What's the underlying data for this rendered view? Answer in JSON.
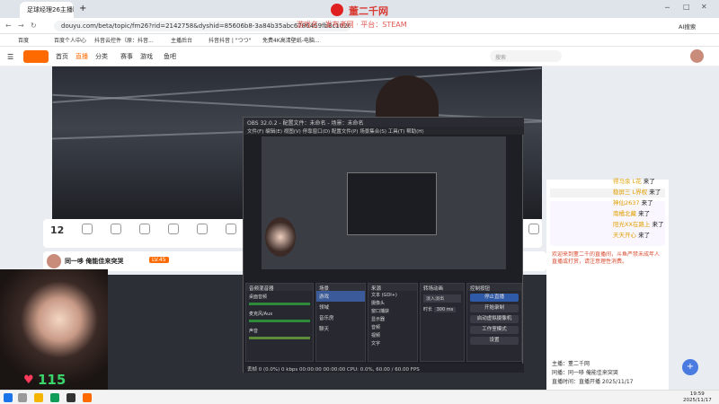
{
  "browser": {
    "tab_title": "足球经理26主播职",
    "url": "douyu.com/beta/topic/fm26?rid=2142758&dyshid=85606b8-3a84b35abc6786469fb8c10200011701",
    "ai_label": "AI搜索",
    "bookmarks": [
      "百度",
      "百度个人中心",
      "抖音云控件（原：抖音...",
      "抖音云控件",
      "主播后台",
      "抖音抖音 | \"つつ\"",
      "免费4K高清壁纸-电脑..."
    ]
  },
  "overlay": {
    "logo_text": "董二千网",
    "subtitle": "游戏名 · 发布者网 · 平台：STEAM"
  },
  "site": {
    "nav": [
      "首页",
      "直播",
      "分类",
      "赛事",
      "游戏",
      "鱼吧"
    ],
    "search_placeholder": "搜索"
  },
  "toolbar": {
    "count": "12",
    "items": [
      "",
      "",
      "",
      "",
      "",
      "",
      "",
      "",
      "",
      "",
      "",
      "",
      ""
    ]
  },
  "stream": {
    "streamer_name": "同一哆 俺能佳来突哭",
    "level": "LV.45"
  },
  "chat_float": [
    {
      "name": "得马余 L花",
      "action": "来了"
    },
    {
      "name": "稳屏三 L界权",
      "action": "来了"
    },
    {
      "name": "神仙2637",
      "action": "来了"
    },
    {
      "name": "南橘北藏",
      "action": "来了"
    },
    {
      "name": "阳光XX在路上",
      "action": "来了"
    },
    {
      "name": "天天开心",
      "action": "来了"
    },
    {
      "name": "大兄弟",
      "action": "来了"
    }
  ],
  "sidebar": {
    "tabs": [
      "",
      "",
      ""
    ],
    "chat_notice": "欢迎来到董二千的直播间，斗鱼严禁未成年人直播或打赏，请注意理性消费。",
    "footer_lines": [
      "主播：董二千网",
      "同播：同一哆 俺能佳来突哭",
      "直播时间：直播开播 2025/11/17"
    ]
  },
  "obs": {
    "title": "OBS 32.0.2 - 配置文件：未命名 - 场景：未命名",
    "menu": [
      "文件(F)",
      "编辑(E)",
      "视图(V)",
      "停靠窗口(D)",
      "配置文件(P)",
      "场景集合(S)",
      "工具(T)",
      "帮助(H)"
    ],
    "docks": {
      "scenes": "场景",
      "sources": "来源",
      "mixer": "音频混音器",
      "transitions": "转场动画",
      "controls": "控制按钮"
    },
    "scene_items": [
      "游戏",
      "领域",
      "音乐房",
      "聊天"
    ],
    "source_items": [
      "文本 (GDI+)",
      "摄像头",
      "窗口捕获",
      "显示器",
      "音频",
      "视频",
      "文字"
    ],
    "mixer_channels": [
      "桌面音频",
      "麦克风/Aux",
      "声音"
    ],
    "transition_value": "淡入淡出",
    "duration_label": "时长",
    "duration_value": "300 ms",
    "control_buttons": [
      "停止直播",
      "开始录制",
      "启动虚拟摄像机",
      "工作室模式",
      "设置"
    ],
    "status": "丢帧 0 (0.0%)   0 kbps   00:00:00   00:00:00   CPU: 0.0%, 60.00 / 60.00 FPS"
  },
  "taskbar": {
    "time": "19:59",
    "date": "2025/11/17"
  },
  "webcam": {
    "score": "115"
  }
}
